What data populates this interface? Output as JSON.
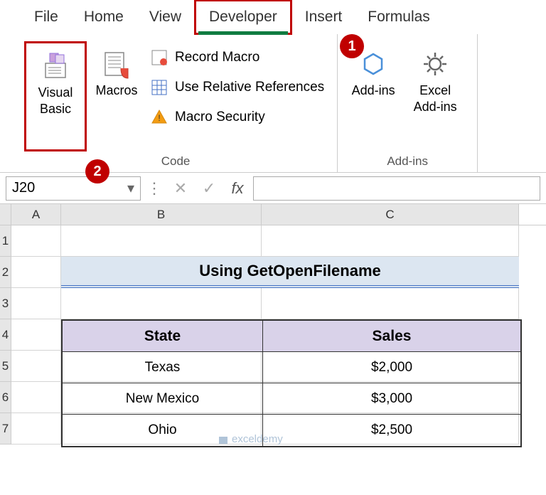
{
  "tabs": {
    "file": "File",
    "home": "Home",
    "view": "View",
    "developer": "Developer",
    "insert": "Insert",
    "formulas": "Formulas"
  },
  "ribbon": {
    "visual_basic": "Visual Basic",
    "macros": "Macros",
    "record_macro": "Record Macro",
    "relative_refs": "Use Relative References",
    "macro_security": "Macro Security",
    "addins": "Add-ins",
    "excel_addins": "Excel Add-ins",
    "code_group": "Code",
    "addins_group": "Add-ins"
  },
  "namebox": "J20",
  "callouts": {
    "one": "1",
    "two": "2"
  },
  "columns": {
    "a": "A",
    "b": "B",
    "c": "C"
  },
  "rows": [
    "1",
    "2",
    "3",
    "4",
    "5",
    "6",
    "7"
  ],
  "title": "Using GetOpenFilename",
  "table": {
    "headers": {
      "state": "State",
      "sales": "Sales"
    },
    "data": [
      {
        "state": "Texas",
        "sales": "$2,000"
      },
      {
        "state": "New Mexico",
        "sales": "$3,000"
      },
      {
        "state": "Ohio",
        "sales": "$2,500"
      }
    ]
  },
  "watermark": "exceldemy"
}
